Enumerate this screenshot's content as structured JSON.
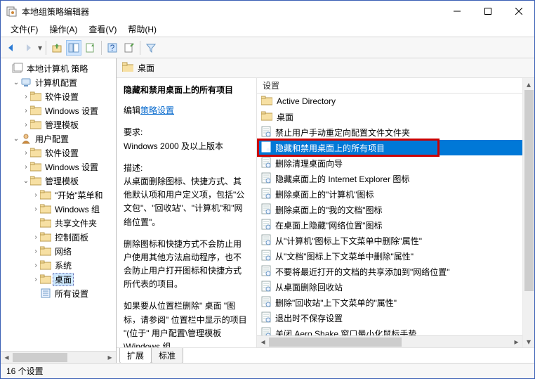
{
  "window": {
    "title": "本地组策略编辑器"
  },
  "menus": {
    "file": "文件(F)",
    "action": "操作(A)",
    "view": "查看(V)",
    "help": "帮助(H)"
  },
  "tree": {
    "root": "本地计算机 策略",
    "computer_cfg": "计算机配置",
    "c_software": "软件设置",
    "c_windows": "Windows 设置",
    "c_admin": "管理模板",
    "user_cfg": "用户配置",
    "u_software": "软件设置",
    "u_windows": "Windows 设置",
    "u_admin": "管理模板",
    "u_start": "\"开始\"菜单和",
    "u_wincomp": "Windows 组",
    "u_shared": "共享文件夹",
    "u_cp": "控制面板",
    "u_net": "网络",
    "u_sys": "系统",
    "u_desktop": "桌面",
    "u_all": "所有设置"
  },
  "header": {
    "label": "桌面"
  },
  "detail": {
    "title": "隐藏和禁用桌面上的所有项目",
    "edit_prefix": "编辑",
    "edit_link": "策略设置",
    "req_label": "要求:",
    "req_value": "Windows 2000 及以上版本",
    "desc_label": "描述:",
    "desc_p1": "从桌面删除图标、快捷方式、其他默认项和用户定义项，包括\"公文包\"、\"回收站\"、\"计算机\"和\"网络位置\"。",
    "desc_p2": "删除图标和快捷方式不会防止用户使用其他方法启动程序，也不会防止用户打开图标和快捷方式所代表的项目。",
    "desc_p3": "如果要从位置栏删除\" 桌面 \"图标，请参阅\" 位置栏中显示的项目 \"(位于\" 用户配置\\管理模板\\Windows 组"
  },
  "listheader": "设置",
  "settings": [
    {
      "type": "folder",
      "label": "Active Directory"
    },
    {
      "type": "folder",
      "label": "桌面"
    },
    {
      "type": "policy",
      "label": "禁止用户手动重定向配置文件文件夹"
    },
    {
      "type": "policy",
      "label": "隐藏和禁用桌面上的所有项目",
      "selected": true
    },
    {
      "type": "policy",
      "label": "删除清理桌面向导"
    },
    {
      "type": "policy",
      "label": "隐藏桌面上的 Internet Explorer 图标"
    },
    {
      "type": "policy",
      "label": "删除桌面上的\"计算机\"图标"
    },
    {
      "type": "policy",
      "label": "删除桌面上的\"我的文档\"图标"
    },
    {
      "type": "policy",
      "label": "在桌面上隐藏\"网络位置\"图标"
    },
    {
      "type": "policy",
      "label": "从\"计算机\"图标上下文菜单中删除\"属性\""
    },
    {
      "type": "policy",
      "label": "从\"文档\"图标上下文菜单中删除\"属性\""
    },
    {
      "type": "policy",
      "label": "不要将最近打开的文档的共享添加到\"网络位置\""
    },
    {
      "type": "policy",
      "label": "从桌面删除回收站"
    },
    {
      "type": "policy",
      "label": "删除\"回收站\"上下文菜单的\"属性\""
    },
    {
      "type": "policy",
      "label": "退出时不保存设置"
    },
    {
      "type": "policy",
      "label": "关闭 Aero Shake 窗口最小化鼠标手势"
    }
  ],
  "tabs": {
    "extended": "扩展",
    "standard": "标准"
  },
  "status": "16 个设置"
}
